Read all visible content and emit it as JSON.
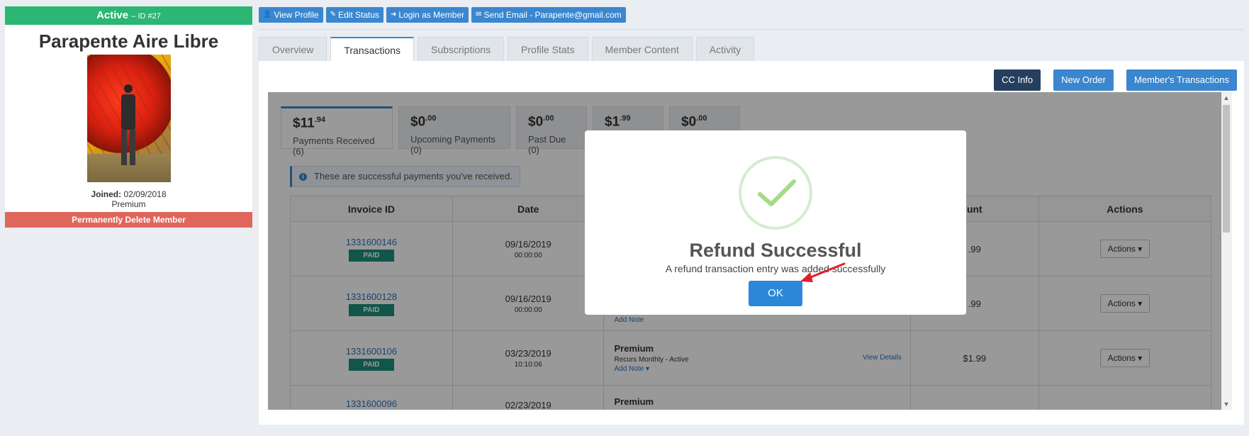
{
  "member": {
    "status": "Active",
    "id_label": "– ID #27",
    "name": "Parapente Aire Libre",
    "joined_label": "Joined:",
    "joined_date": "02/09/2018",
    "plan": "Premium",
    "delete_label": "Permanently Delete Member"
  },
  "toolbar": {
    "view_profile": "View Profile",
    "edit_status": "Edit Status",
    "login_as_member": "Login as Member",
    "send_email": "Send Email - Parapente@gmail.com"
  },
  "tabs": [
    {
      "label": "Overview"
    },
    {
      "label": "Transactions"
    },
    {
      "label": "Subscriptions"
    },
    {
      "label": "Profile Stats"
    },
    {
      "label": "Member Content"
    },
    {
      "label": "Activity"
    }
  ],
  "panel_actions": {
    "cc_info": "CC Info",
    "new_order": "New Order",
    "members_transactions": "Member's Transactions"
  },
  "summary": [
    {
      "amount": "$11",
      "cents": ".94",
      "label": "Payments Received (6)"
    },
    {
      "amount": "$0",
      "cents": ".00",
      "label": "Upcoming Payments (0)"
    },
    {
      "amount": "$0",
      "cents": ".00",
      "label": "Past Due (0)"
    },
    {
      "amount": "$1",
      "cents": ".99",
      "label": ""
    },
    {
      "amount": "$0",
      "cents": ".00",
      "label": ""
    }
  ],
  "info_text": "These are successful payments you've received.",
  "table": {
    "headers": {
      "invoice": "Invoice ID",
      "date": "Date",
      "amount": "unt",
      "actions": "Actions"
    },
    "rows": [
      {
        "invoice": "1331600146",
        "status": "PAID",
        "date": "09/16/2019",
        "time": "00:00:00",
        "product": "",
        "recurs": "",
        "note": "",
        "view": "",
        "amount": ".99",
        "action": "Actions"
      },
      {
        "invoice": "1331600128",
        "status": "PAID",
        "date": "09/16/2019",
        "time": "00:00:00",
        "product": "",
        "recurs": "",
        "note": "Add Note",
        "view": "",
        "amount": ".99",
        "action": "Actions"
      },
      {
        "invoice": "1331600106",
        "status": "PAID",
        "date": "03/23/2019",
        "time": "10:10:06",
        "product": "Premium",
        "recurs": "Recurs Monthly - Active",
        "note": "Add Note ▾",
        "view": "View Details",
        "amount": "$1.99",
        "action": "Actions"
      },
      {
        "invoice": "1331600096",
        "status": "",
        "date": "02/23/2019",
        "time": "",
        "product": "Premium",
        "recurs": "",
        "note": "",
        "view": "",
        "amount": "",
        "action": ""
      }
    ]
  },
  "modal": {
    "title": "Refund Successful",
    "text": "A refund transaction entry was added successfully",
    "ok_label": "OK"
  },
  "colors": {
    "active_green": "#2bb673",
    "primary_blue": "#3a87cf",
    "danger_red": "#e0665c",
    "paid_teal": "#1d8f7c",
    "dark_navy": "#25405e"
  }
}
